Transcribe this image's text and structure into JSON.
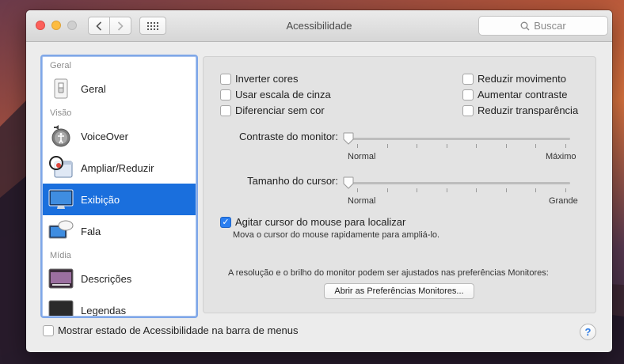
{
  "window": {
    "title": "Acessibilidade",
    "search_placeholder": "Buscar"
  },
  "sidebar": {
    "sections": [
      {
        "label": "Geral"
      },
      {
        "label": "Visão"
      },
      {
        "label": "Mídia"
      }
    ],
    "items": [
      {
        "label": "Geral",
        "icon": "switch-icon",
        "selected": false
      },
      {
        "label": "VoiceOver",
        "icon": "voiceover-icon",
        "selected": false
      },
      {
        "label": "Ampliar/Reduzir",
        "icon": "magnifier-icon",
        "selected": false
      },
      {
        "label": "Exibição",
        "icon": "display-icon",
        "selected": true
      },
      {
        "label": "Fala",
        "icon": "speech-icon",
        "selected": false
      },
      {
        "label": "Descrições",
        "icon": "descriptions-icon",
        "selected": false
      },
      {
        "label": "Legendas",
        "icon": "captions-icon",
        "selected": false
      }
    ]
  },
  "options": {
    "left": [
      {
        "label": "Inverter cores",
        "checked": false
      },
      {
        "label": "Usar escala de cinza",
        "checked": false
      },
      {
        "label": "Diferenciar sem cor",
        "checked": false
      }
    ],
    "right": [
      {
        "label": "Reduzir movimento",
        "checked": false
      },
      {
        "label": "Aumentar contraste",
        "checked": false
      },
      {
        "label": "Reduzir transparência",
        "checked": false
      }
    ]
  },
  "contrast": {
    "label": "Contraste do monitor:",
    "min_label": "Normal",
    "max_label": "Máximo",
    "value": 0
  },
  "cursor": {
    "label": "Tamanho do cursor:",
    "min_label": "Normal",
    "max_label": "Grande",
    "value": 0
  },
  "shake": {
    "label": "Agitar cursor do mouse para localizar",
    "description": "Mova o cursor do mouse rapidamente para ampliá-lo.",
    "checked": true
  },
  "monitors": {
    "note": "A resolução e o brilho do monitor podem ser ajustados nas preferências Monitores:",
    "button_label": "Abrir as Preferências Monitores..."
  },
  "footer": {
    "menubar_label": "Mostrar estado de Acessibilidade na barra de menus",
    "menubar_checked": false,
    "help_label": "?"
  },
  "colors": {
    "accent": "#1a6fdd",
    "close": "#fc605b",
    "minimize": "#fdbc40"
  }
}
